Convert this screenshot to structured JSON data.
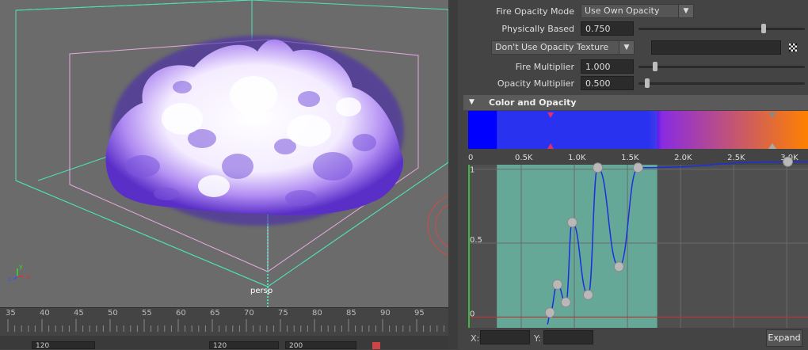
{
  "viewport": {
    "camera_label": "persp",
    "axis_labels": {
      "x": "x",
      "y": "y",
      "z": "z"
    }
  },
  "timeline": {
    "frame_labels": [
      "35",
      "40",
      "45",
      "50",
      "55",
      "60",
      "65",
      "70",
      "75",
      "80",
      "85",
      "90",
      "95"
    ],
    "range_fields": [
      "120",
      "120",
      "200"
    ]
  },
  "attributes": {
    "fire_opacity_mode": {
      "label": "Fire Opacity Mode",
      "value": "Use Own Opacity",
      "arrow": "▼"
    },
    "physically_based": {
      "label": "Physically Based",
      "value": "0.750",
      "fraction": 0.75
    },
    "opacity_texture": {
      "value": "Don't Use Opacity Texture",
      "arrow": "▼"
    },
    "fire_multiplier": {
      "label": "Fire Multiplier",
      "value": "1.000",
      "fraction": 0.1
    },
    "opacity_multiplier": {
      "label": "Opacity Multiplier",
      "value": "0.500",
      "fraction": 0.05
    }
  },
  "section": {
    "title": "Color and Opacity",
    "expanded_icon": "▼"
  },
  "gradient_colors": {
    "left": "#0000ff",
    "mid": "#8a2be2",
    "right": "#ff8000",
    "selection": "#66a898"
  },
  "chart_data": {
    "type": "line",
    "x_tick_labels": [
      "0",
      "0.5K",
      "1.0K",
      "1.5K",
      "2.0K",
      "2.5K",
      "3.0K"
    ],
    "x_ticks": [
      0,
      500,
      1000,
      1500,
      2000,
      2500,
      3000
    ],
    "y_tick_labels": [
      "1",
      "0.5",
      "0"
    ],
    "y_ticks": [
      1,
      0.5,
      0
    ],
    "xlim": [
      0,
      3200
    ],
    "ylim": [
      -0.03,
      1.03
    ],
    "selection_range": [
      270,
      1780
    ],
    "points": [
      {
        "x": 770,
        "y": 0.03
      },
      {
        "x": 840,
        "y": 0.22
      },
      {
        "x": 920,
        "y": 0.1
      },
      {
        "x": 980,
        "y": 0.64
      },
      {
        "x": 1130,
        "y": 0.15
      },
      {
        "x": 1220,
        "y": 1.01
      },
      {
        "x": 1420,
        "y": 0.34
      },
      {
        "x": 1600,
        "y": 1.01
      },
      {
        "x": 3010,
        "y": 1.05
      }
    ],
    "line_color": "#1a2fe0"
  },
  "footer": {
    "x_label": "X:",
    "y_label": "Y:",
    "expand_button": "Expand"
  }
}
